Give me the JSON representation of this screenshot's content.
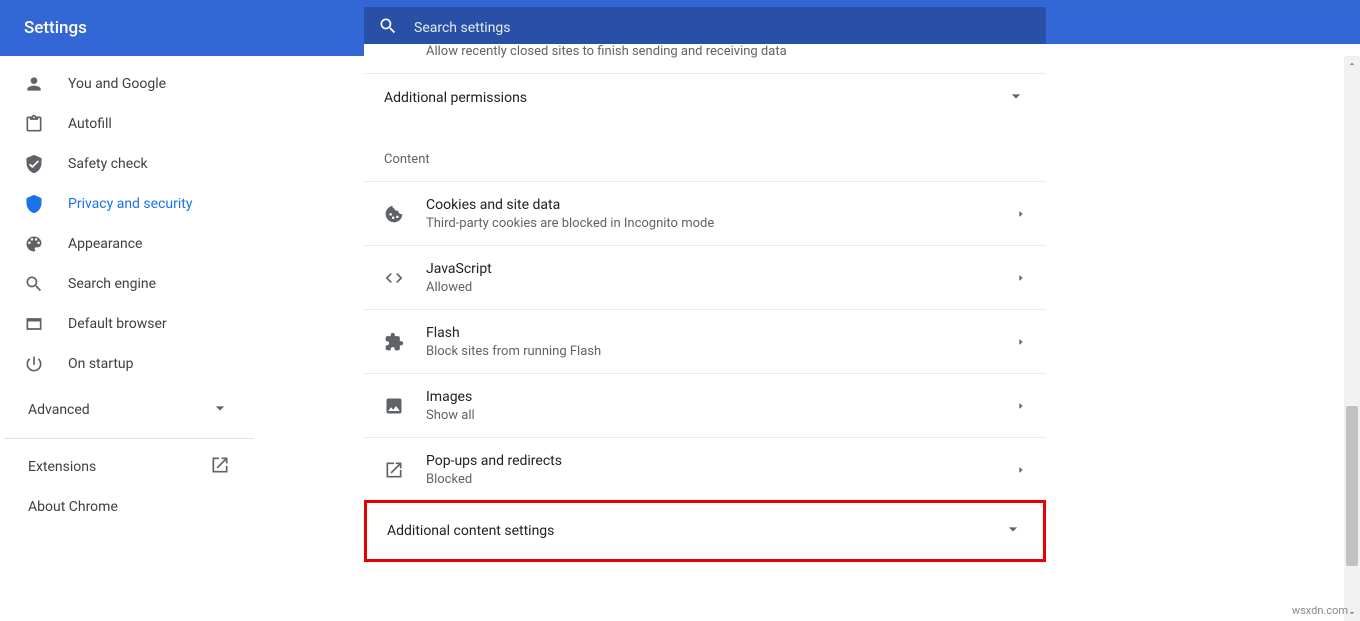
{
  "header": {
    "title": "Settings",
    "search_placeholder": "Search settings"
  },
  "sidebar": {
    "items": [
      {
        "label": "You and Google"
      },
      {
        "label": "Autofill"
      },
      {
        "label": "Safety check"
      },
      {
        "label": "Privacy and security"
      },
      {
        "label": "Appearance"
      },
      {
        "label": "Search engine"
      },
      {
        "label": "Default browser"
      },
      {
        "label": "On startup"
      }
    ],
    "advanced_label": "Advanced",
    "extensions_label": "Extensions",
    "about_label": "About Chrome"
  },
  "main": {
    "cut_desc": "Allow recently closed sites to finish sending and receiving data",
    "additional_permissions_label": "Additional permissions",
    "content_section_label": "Content",
    "rows": [
      {
        "title": "Cookies and site data",
        "sub": "Third-party cookies are blocked in Incognito mode"
      },
      {
        "title": "JavaScript",
        "sub": "Allowed"
      },
      {
        "title": "Flash",
        "sub": "Block sites from running Flash"
      },
      {
        "title": "Images",
        "sub": "Show all"
      },
      {
        "title": "Pop-ups and redirects",
        "sub": "Blocked"
      }
    ],
    "additional_content_label": "Additional content settings"
  },
  "watermark": "wsxdn.com"
}
